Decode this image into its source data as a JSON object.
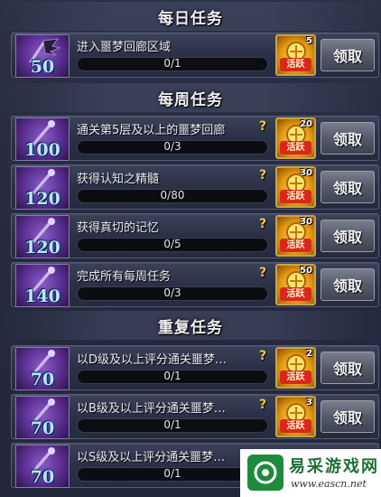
{
  "sections": [
    {
      "title": "每日任务"
    },
    {
      "title": "每周任务"
    },
    {
      "title": "重复任务"
    }
  ],
  "tasks": [
    {
      "level": "50",
      "name": "进入噩梦回廊区域",
      "progress": "0/1",
      "has_help": false,
      "reward_count": "5",
      "reward_label": "活跃",
      "button": "领取"
    },
    {
      "level": "100",
      "name": "通关第5层及以上的噩梦回廊",
      "progress": "0/3",
      "has_help": true,
      "reward_count": "20",
      "reward_label": "活跃",
      "button": "领取"
    },
    {
      "level": "120",
      "name": "获得认知之精髓",
      "progress": "0/80",
      "has_help": true,
      "reward_count": "30",
      "reward_label": "活跃",
      "button": "领取"
    },
    {
      "level": "120",
      "name": "获得真切的记忆",
      "progress": "0/5",
      "has_help": true,
      "reward_count": "30",
      "reward_label": "活跃",
      "button": "领取"
    },
    {
      "level": "140",
      "name": "完成所有每周任务",
      "progress": "0/3",
      "has_help": true,
      "reward_count": "50",
      "reward_label": "活跃",
      "button": "领取"
    },
    {
      "level": "70",
      "name": "以D级及以上评分通关噩梦…",
      "progress": "0/1",
      "has_help": true,
      "reward_count": "2",
      "reward_label": "活跃",
      "button": "领取"
    },
    {
      "level": "70",
      "name": "以B级及以上评分通关噩梦…",
      "progress": "0/1",
      "has_help": true,
      "reward_count": "3",
      "reward_label": "活跃",
      "button": "领取"
    },
    {
      "level": "70",
      "name": "以S级及以上评分通关噩梦…",
      "progress": "0/1",
      "has_help": false,
      "reward_count": "",
      "reward_label": "",
      "button": ""
    }
  ],
  "help_glyph": "?",
  "watermark": {
    "title": "易采游戏网",
    "url": "www.eascn.net"
  },
  "colors": {
    "accent": "#f2c94a",
    "reward_label_bg": "#d8281e",
    "badge": "#5b2f92"
  }
}
